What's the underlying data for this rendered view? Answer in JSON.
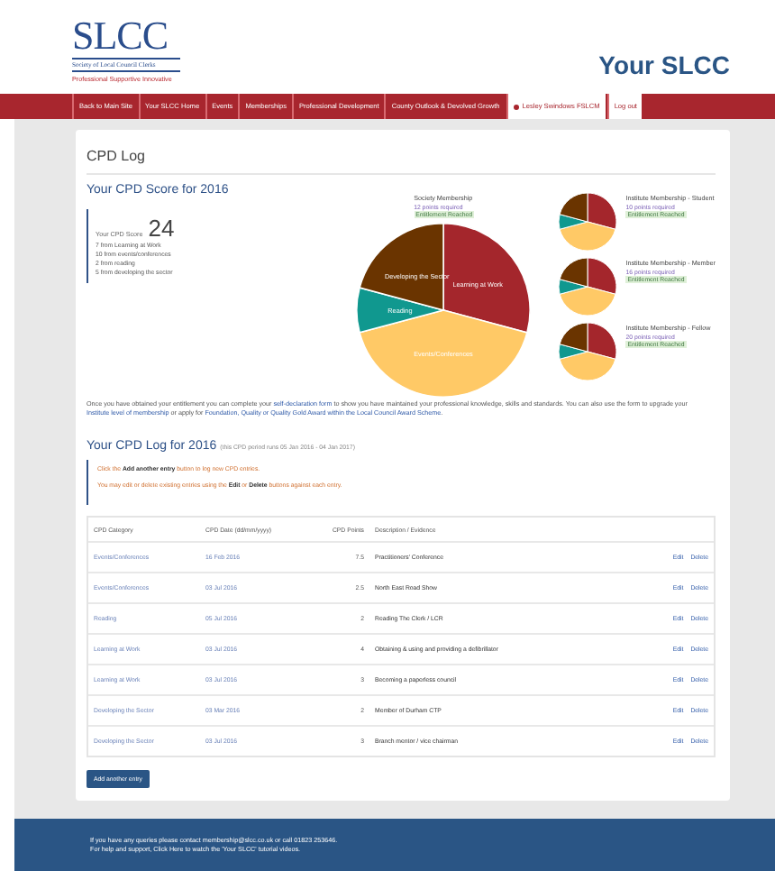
{
  "header": {
    "logo": {
      "title": "SLCC",
      "subtitle": "Society of Local Council Clerks",
      "tagline": "Professional Supportive Innovative"
    },
    "site_title": "Your SLCC"
  },
  "nav": {
    "items": [
      {
        "label": "Back to Main Site",
        "kind": "menu"
      },
      {
        "label": "Your SLCC Home",
        "kind": "menu"
      },
      {
        "label": "Events",
        "kind": "menu"
      },
      {
        "label": "Memberships",
        "kind": "menu"
      },
      {
        "label": "Professional Development",
        "kind": "menu"
      },
      {
        "label": "County Outlook & Devolved Growth",
        "kind": "menu"
      },
      {
        "label": "Lesley Swindows FSLCM",
        "kind": "account"
      },
      {
        "label": "Log out",
        "kind": "account-plain"
      }
    ]
  },
  "page_title": "CPD Log",
  "score": {
    "title": "Your CPD Score for 2016",
    "label": "Your CPD Score",
    "value": "24",
    "breakdown": [
      "7 from Learning at Work",
      "10 from events/conferences",
      "2 from reading",
      "5 from developing the sector"
    ]
  },
  "chart_data": {
    "type": "pie",
    "categories": [
      "Learning at Work",
      "Events/Conferences",
      "Reading",
      "Developing the Sector"
    ],
    "values": [
      29.17,
      41.67,
      8.33,
      20.83
    ],
    "colors": [
      "#a4262c",
      "#ffc966",
      "#10988f",
      "#6a3400"
    ]
  },
  "society": {
    "name": "Society Membership",
    "requirement": "12 points required",
    "status": "Entitlement Reached"
  },
  "institute_levels": [
    {
      "name": "Institute Membership - Student",
      "requirement": "10 points required",
      "status": "Entitlement Reached"
    },
    {
      "name": "Institute Membership - Member",
      "requirement": "16 points required",
      "status": "Entitlement Reached"
    },
    {
      "name": "Institute Membership - Fellow",
      "requirement": "20 points required",
      "status": "Entitlement Reached"
    }
  ],
  "entitlement_note": [
    {
      "text": "Once you have obtained your entitlement you can complete your ",
      "kind": "text"
    },
    {
      "text": "self-declaration form",
      "kind": "link"
    },
    {
      "text": " to show you have maintained your professional knowledge, skills and standards. You can also use the form to upgrade your ",
      "kind": "text"
    },
    {
      "text": "Institute level of membership",
      "kind": "link"
    },
    {
      "text": " or apply for ",
      "kind": "text"
    },
    {
      "text": "Foundation, Quality or Quality Gold Award within the Local Council Award Scheme",
      "kind": "link"
    },
    {
      "text": ".",
      "kind": "text"
    }
  ],
  "log": {
    "title": "Your CPD Log for 2016",
    "period": "(this CPD period runs 05 Jan 2016 - 04 Jan 2017)",
    "info": [
      "Click the **Add another entry** button to log new CPD entries.",
      "You may edit or delete existing entries using the **Edit** or **Delete** buttons against each entry."
    ],
    "columns": [
      "CPD Category",
      "CPD Date (dd/mm/yyyy)",
      "CPD Points",
      "Description / Evidence"
    ],
    "rows": [
      {
        "category": "Events/Conferences",
        "date": "16 Feb 2016",
        "points": "7.5",
        "description": "Practitioners' Conference",
        "edit": "Edit",
        "delete": "Delete"
      },
      {
        "category": "Events/Conferences",
        "date": "03 Jul 2016",
        "points": "2.5",
        "description": "North East Road Show",
        "edit": "Edit",
        "delete": "Delete"
      },
      {
        "category": "Reading",
        "date": "05 Jul 2016",
        "points": "2",
        "description": "Reading The Clerk / LCR",
        "edit": "Edit",
        "delete": "Delete"
      },
      {
        "category": "Learning at Work",
        "date": "03 Jul 2016",
        "points": "4",
        "description": "Obtaining & using and providing a defibrillator",
        "edit": "Edit",
        "delete": "Delete"
      },
      {
        "category": "Learning at Work",
        "date": "03 Jul 2016",
        "points": "3",
        "description": "Becoming a paperless council",
        "edit": "Edit",
        "delete": "Delete"
      },
      {
        "category": "Developing the Sector",
        "date": "03 Mar 2016",
        "points": "2",
        "description": "Member of Durham CTP",
        "edit": "Edit",
        "delete": "Delete"
      },
      {
        "category": "Developing the Sector",
        "date": "03 Jul 2016",
        "points": "3",
        "description": "Branch mentor / vice chairman",
        "edit": "Edit",
        "delete": "Delete"
      }
    ],
    "add_button": "Add another entry"
  },
  "footer": {
    "lines": [
      "If you have any queries please contact membership@slcc.co.uk or call 01823 253646.",
      "For help and support, Click Here to watch the 'Your SLCC' tutorial videos."
    ]
  }
}
